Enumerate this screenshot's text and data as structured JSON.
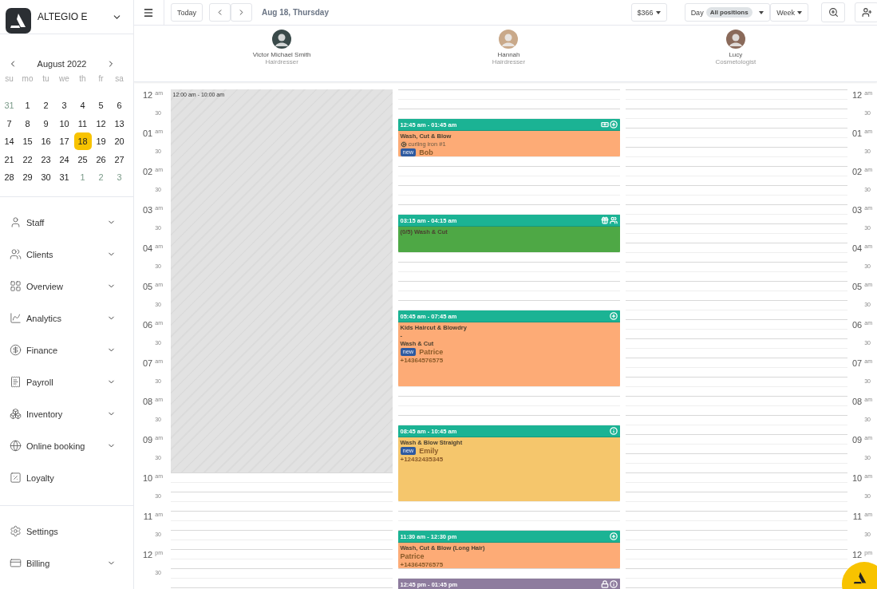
{
  "brand": {
    "name": "ALTEGIO E"
  },
  "mini_calendar": {
    "month": "August 2022",
    "weekdays": [
      "su",
      "mo",
      "tu",
      "we",
      "th",
      "fr",
      "sa"
    ],
    "weeks": [
      [
        {
          "day": "31",
          "muted": true,
          "selected": false
        },
        {
          "day": "1",
          "muted": false,
          "selected": false
        },
        {
          "day": "2",
          "muted": false,
          "selected": false
        },
        {
          "day": "3",
          "muted": false,
          "selected": false
        },
        {
          "day": "4",
          "muted": false,
          "selected": false
        },
        {
          "day": "5",
          "muted": false,
          "selected": false
        },
        {
          "day": "6",
          "muted": false,
          "selected": false
        }
      ],
      [
        {
          "day": "7",
          "muted": false,
          "selected": false
        },
        {
          "day": "8",
          "muted": false,
          "selected": false
        },
        {
          "day": "9",
          "muted": false,
          "selected": false
        },
        {
          "day": "10",
          "muted": false,
          "selected": false
        },
        {
          "day": "11",
          "muted": false,
          "selected": false
        },
        {
          "day": "12",
          "muted": false,
          "selected": false
        },
        {
          "day": "13",
          "muted": false,
          "selected": false
        }
      ],
      [
        {
          "day": "14",
          "muted": false,
          "selected": false
        },
        {
          "day": "15",
          "muted": false,
          "selected": false
        },
        {
          "day": "16",
          "muted": false,
          "selected": false
        },
        {
          "day": "17",
          "muted": false,
          "selected": false
        },
        {
          "day": "18",
          "muted": false,
          "selected": true
        },
        {
          "day": "19",
          "muted": false,
          "selected": false
        },
        {
          "day": "20",
          "muted": false,
          "selected": false
        }
      ],
      [
        {
          "day": "21",
          "muted": false,
          "selected": false
        },
        {
          "day": "22",
          "muted": false,
          "selected": false
        },
        {
          "day": "23",
          "muted": false,
          "selected": false
        },
        {
          "day": "24",
          "muted": false,
          "selected": false
        },
        {
          "day": "25",
          "muted": false,
          "selected": false
        },
        {
          "day": "26",
          "muted": false,
          "selected": false
        },
        {
          "day": "27",
          "muted": false,
          "selected": false
        }
      ],
      [
        {
          "day": "28",
          "muted": false,
          "selected": false
        },
        {
          "day": "29",
          "muted": false,
          "selected": false
        },
        {
          "day": "30",
          "muted": false,
          "selected": false
        },
        {
          "day": "31",
          "muted": false,
          "selected": false
        },
        {
          "day": "1",
          "muted": true,
          "selected": false
        },
        {
          "day": "2",
          "muted": true,
          "selected": false
        },
        {
          "day": "3",
          "muted": true,
          "selected": false
        }
      ]
    ]
  },
  "nav": [
    {
      "kind": "staff",
      "label": "Staff",
      "expandable": true
    },
    {
      "kind": "clients",
      "label": "Clients",
      "expandable": true
    },
    {
      "kind": "overview",
      "label": "Overview",
      "expandable": true
    },
    {
      "kind": "analytics",
      "label": "Analytics",
      "expandable": true
    },
    {
      "kind": "finance",
      "label": "Finance",
      "expandable": true
    },
    {
      "kind": "payroll",
      "label": "Payroll",
      "expandable": true
    },
    {
      "kind": "inventory",
      "label": "Inventory",
      "expandable": true
    },
    {
      "kind": "booking",
      "label": "Online booking",
      "expandable": true
    },
    {
      "kind": "loyalty",
      "label": "Loyalty",
      "expandable": false
    }
  ],
  "nav_bottom": [
    {
      "kind": "settings",
      "label": "Settings",
      "expandable": false
    },
    {
      "kind": "billing",
      "label": "Billing",
      "expandable": true
    }
  ],
  "toolbar": {
    "today": "Today",
    "date": "Aug 18, Thursday",
    "revenue": "$366",
    "day": "Day",
    "positions": "All positions",
    "week": "Week"
  },
  "staff": [
    {
      "name": "Victor Michael Smith",
      "role": "Hairdresser",
      "color": "#3a4a4a"
    },
    {
      "name": "Hannah",
      "role": "Hairdresser",
      "color": "#c9a98a"
    },
    {
      "name": "Lucy",
      "role": "Cosmetologist",
      "color": "#8a6a5a"
    }
  ],
  "time_axis_left": [
    {
      "hour": "12",
      "period": "am",
      "half": "30"
    },
    {
      "hour": "01",
      "period": "am",
      "half": "30"
    },
    {
      "hour": "02",
      "period": "am",
      "half": "30"
    },
    {
      "hour": "03",
      "period": "am",
      "half": "30"
    },
    {
      "hour": "04",
      "period": "am",
      "half": "30"
    },
    {
      "hour": "05",
      "period": "am",
      "half": "30"
    },
    {
      "hour": "06",
      "period": "am",
      "half": "30"
    },
    {
      "hour": "07",
      "period": "am",
      "half": "30"
    },
    {
      "hour": "08",
      "period": "am",
      "half": "30"
    },
    {
      "hour": "09",
      "period": "am",
      "half": "30"
    },
    {
      "hour": "10",
      "period": "am",
      "half": "30"
    },
    {
      "hour": "11",
      "period": "am",
      "half": "30"
    },
    {
      "hour": "12",
      "period": "pm",
      "half": "30"
    }
  ],
  "time_axis_right": [
    {
      "hour": "12",
      "period": "am",
      "half": "30"
    },
    {
      "hour": "01",
      "period": "am",
      "half": "30"
    },
    {
      "hour": "02",
      "period": "am",
      "half": "30"
    },
    {
      "hour": "03",
      "period": "am",
      "half": "30"
    },
    {
      "hour": "04",
      "period": "am",
      "half": "30"
    },
    {
      "hour": "05",
      "period": "am",
      "half": "30"
    },
    {
      "hour": "06",
      "period": "am",
      "half": "30"
    },
    {
      "hour": "07",
      "period": "am",
      "half": "30"
    },
    {
      "hour": "08",
      "period": "am",
      "half": "30"
    },
    {
      "hour": "09",
      "period": "am",
      "half": "30"
    },
    {
      "hour": "10",
      "period": "am",
      "half": "30"
    },
    {
      "hour": "11",
      "period": "am",
      "half": "30"
    },
    {
      "hour": "12",
      "period": "pm"
    }
  ],
  "columns": [
    {
      "blocks": [
        {
          "kind": "off",
          "time": "12:00 am - 10:00 am"
        }
      ]
    },
    {
      "blocks": [
        {
          "kind": "confirmed",
          "time": "12:45 am - 01:45 am",
          "color": "#fdab76",
          "lines": [
            {
              "kind": "service",
              "text": "Wash, Cut & Blow"
            },
            {
              "kind": "resource",
              "text": "curling iron #1"
            },
            {
              "kind": "client",
              "badge": "new",
              "text": "Bob"
            }
          ]
        },
        {
          "kind": "confirmed",
          "time": "03:15 am - 04:15 am",
          "color": "#4ea845",
          "lines": [
            {
              "kind": "service",
              "text": "(0/5) Wash & Cut"
            }
          ]
        },
        {
          "kind": "confirmed",
          "time": "05:45 am - 07:45 am",
          "color": "#fdab76",
          "lines": [
            {
              "kind": "service",
              "text": "Kids Haircut & Blowdry"
            },
            {
              "kind": "service",
              "text": "-"
            },
            {
              "kind": "service",
              "text": "Wash & Cut"
            },
            {
              "kind": "client",
              "badge": "new",
              "text": "Patrice"
            },
            {
              "kind": "phone",
              "text": "+14364576575"
            }
          ]
        },
        {
          "kind": "confirmed",
          "time": "08:45 am - 10:45 am",
          "color": "#f5c66c",
          "lines": [
            {
              "kind": "service",
              "text": "Wash & Blow Straight"
            },
            {
              "kind": "client",
              "badge": "new",
              "text": "Emily"
            },
            {
              "kind": "phone",
              "text": "+12432435345"
            }
          ]
        },
        {
          "kind": "confirmed",
          "time": "11:30 am - 12:30 pm",
          "color": "#fdab76",
          "lines": [
            {
              "kind": "service",
              "text": "Wash, Cut & Blow (Long Hair)"
            },
            {
              "kind": "client",
              "text": "Patrice"
            },
            {
              "kind": "phone",
              "text": "+14364576575"
            }
          ]
        },
        {
          "kind": "pending",
          "time": "12:45 pm - 01:45 pm",
          "color": "#8e7c9e"
        }
      ]
    },
    {}
  ]
}
